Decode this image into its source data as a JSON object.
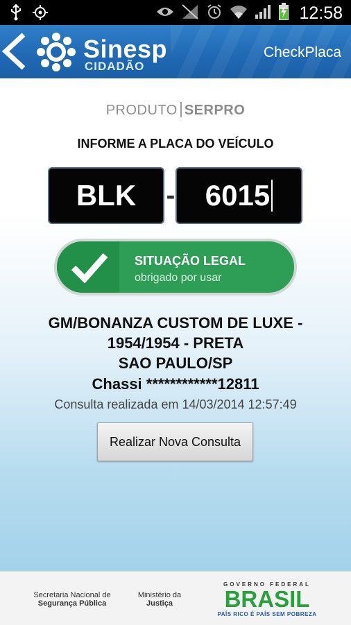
{
  "status_bar": {
    "time": "12:58",
    "left_icons": [
      "usb-icon",
      "gps-icon"
    ],
    "right_icons": [
      "eye-icon",
      "no-signal-icon",
      "alarm-icon",
      "wifi-icon",
      "cell-signal-icon",
      "battery-charging-icon"
    ]
  },
  "app_bar": {
    "back_icon": "chevron-left-icon",
    "logo_text": "Sinesp",
    "logo_sub": "CIDADÃO",
    "title": "CheckPlaca"
  },
  "main": {
    "produto_left": "PRODUTO",
    "produto_right": "SERPRO",
    "instruction": "INFORME A PLACA DO VEÍCULO",
    "plate_letters": "BLK",
    "plate_separator": "-",
    "plate_numbers": "6015",
    "status": {
      "title": "SITUAÇÃO LEGAL",
      "subtitle": "obrigado por usar",
      "icon": "checkmark-icon",
      "color": "#2e9e57"
    },
    "vehicle_line1": "GM/BONANZA CUSTOM DE LUXE -",
    "vehicle_line2": "1954/1954 - PRETA",
    "vehicle_line3": "SAO PAULO/SP",
    "chassi": "Chassi ************12811",
    "consulta": "Consulta realizada em 14/03/2014 12:57:49",
    "new_query_button": "Realizar Nova Consulta"
  },
  "footer": {
    "secretaria_line1": "Secretaria Nacional de",
    "secretaria_line2": "Segurança Pública",
    "ministerio_line1": "Ministério da",
    "ministerio_line2": "Justiça",
    "gov_top": "GOVERNO FEDERAL",
    "gov_brasil": "BRASIL",
    "gov_tagline": "PAÍS RICO É PAÍS SEM POBREZA"
  }
}
